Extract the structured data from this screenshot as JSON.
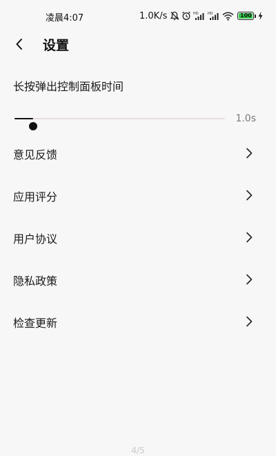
{
  "status_bar": {
    "time": "凌晨4:07",
    "net_speed": "1.0K/s",
    "battery_level": "100",
    "icons": [
      "mute-icon",
      "alarm-icon",
      "hd-signal-icon",
      "hd-signal-icon",
      "wifi-icon",
      "battery-icon",
      "charging-icon"
    ]
  },
  "header": {
    "back_icon": "chevron-left-icon",
    "title": "设置"
  },
  "press_setting": {
    "label": "长按弹出控制面板时间",
    "value": "1.0s",
    "fraction": 0.09
  },
  "menu": {
    "items": [
      {
        "label": "意见反馈",
        "icon": "chevron-right-icon"
      },
      {
        "label": "应用评分",
        "icon": "chevron-right-icon"
      },
      {
        "label": "用户协议",
        "icon": "chevron-right-icon"
      },
      {
        "label": "隐私政策",
        "icon": "chevron-right-icon"
      },
      {
        "label": "检查更新",
        "icon": "chevron-right-icon"
      }
    ]
  },
  "page_indicator": "4/5",
  "colors": {
    "background": "#f7f7f7",
    "slider_active": "#111111",
    "slider_track": "#e6dde0",
    "battery": "#35c84a"
  }
}
